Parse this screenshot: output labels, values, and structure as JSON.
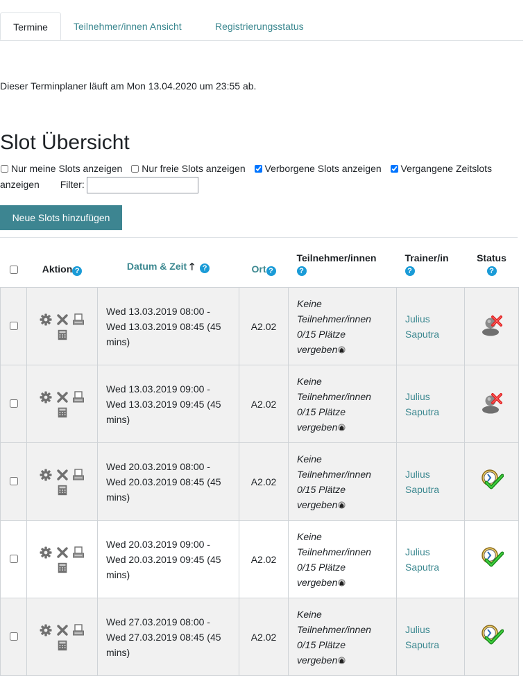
{
  "tabs": [
    {
      "label": "Termine",
      "active": true
    },
    {
      "label": "Teilnehmer/innen Ansicht",
      "active": false
    },
    {
      "label": "Registrierungsstatus",
      "active": false
    }
  ],
  "info_text": "Dieser Terminplaner läuft am Mon 13.04.2020 um 23:55 ab.",
  "heading": "Slot Übersicht",
  "options": {
    "only_mine": {
      "label": "Nur meine Slots anzeigen",
      "checked": false
    },
    "only_free": {
      "label": "Nur freie Slots anzeigen",
      "checked": false
    },
    "show_hidden": {
      "label": "Verborgene Slots anzeigen",
      "checked": true
    },
    "show_past_a": "Vergangene Zeitslots",
    "show_past_b": "anzeigen",
    "show_past_checked": true,
    "filter_label": "Filter:",
    "filter_value": ""
  },
  "add_button": "Neue Slots hinzufügen",
  "table": {
    "headers": {
      "action": "Aktion",
      "datetime": "Datum & Zeit",
      "location": "Ort",
      "participants": "Teilnehmer/innen",
      "trainer": "Trainer/in",
      "status": "Status"
    },
    "help_glyph": "?",
    "sort_glyph": "🡑",
    "rows": [
      {
        "date_line1": "Wed 13.03.2019 08:00 -",
        "date_line2": "Wed 13.03.2019 08:45 (45 mins)",
        "location": "A2.02",
        "part_line1": "Keine Teilnehmer/innen",
        "part_line2": "0/15 Plätze vergeben",
        "trainer": "Julius Saputra",
        "status": "past-blocked"
      },
      {
        "date_line1": "Wed 13.03.2019 09:00 -",
        "date_line2": "Wed 13.03.2019 09:45 (45 mins)",
        "location": "A2.02",
        "part_line1": "Keine Teilnehmer/innen",
        "part_line2": "0/15 Plätze vergeben",
        "trainer": "Julius Saputra",
        "status": "past-blocked"
      },
      {
        "date_line1": "Wed 20.03.2019 08:00 -",
        "date_line2": "Wed 20.03.2019 08:45 (45 mins)",
        "location": "A2.02",
        "part_line1": "Keine Teilnehmer/innen",
        "part_line2": "0/15 Plätze vergeben",
        "trainer": "Julius Saputra",
        "status": "open-check"
      },
      {
        "date_line1": "Wed 20.03.2019 09:00 -",
        "date_line2": "Wed 20.03.2019 09:45 (45 mins)",
        "location": "A2.02",
        "part_line1": "Keine Teilnehmer/innen",
        "part_line2": "0/15 Plätze vergeben",
        "trainer": "Julius Saputra",
        "status": "open-check"
      },
      {
        "date_line1": "Wed 27.03.2019 08:00 -",
        "date_line2": "Wed 27.03.2019 08:45 (45 mins)",
        "location": "A2.02",
        "part_line1": "Keine Teilnehmer/innen",
        "part_line2": "0/15 Plätze vergeben",
        "trainer": "Julius Saputra",
        "status": "open-check"
      }
    ]
  },
  "colors": {
    "accent": "#3d8591",
    "link": "#3c8890",
    "help": "#1a9bd7",
    "row_grey": "#f1f1f1"
  }
}
